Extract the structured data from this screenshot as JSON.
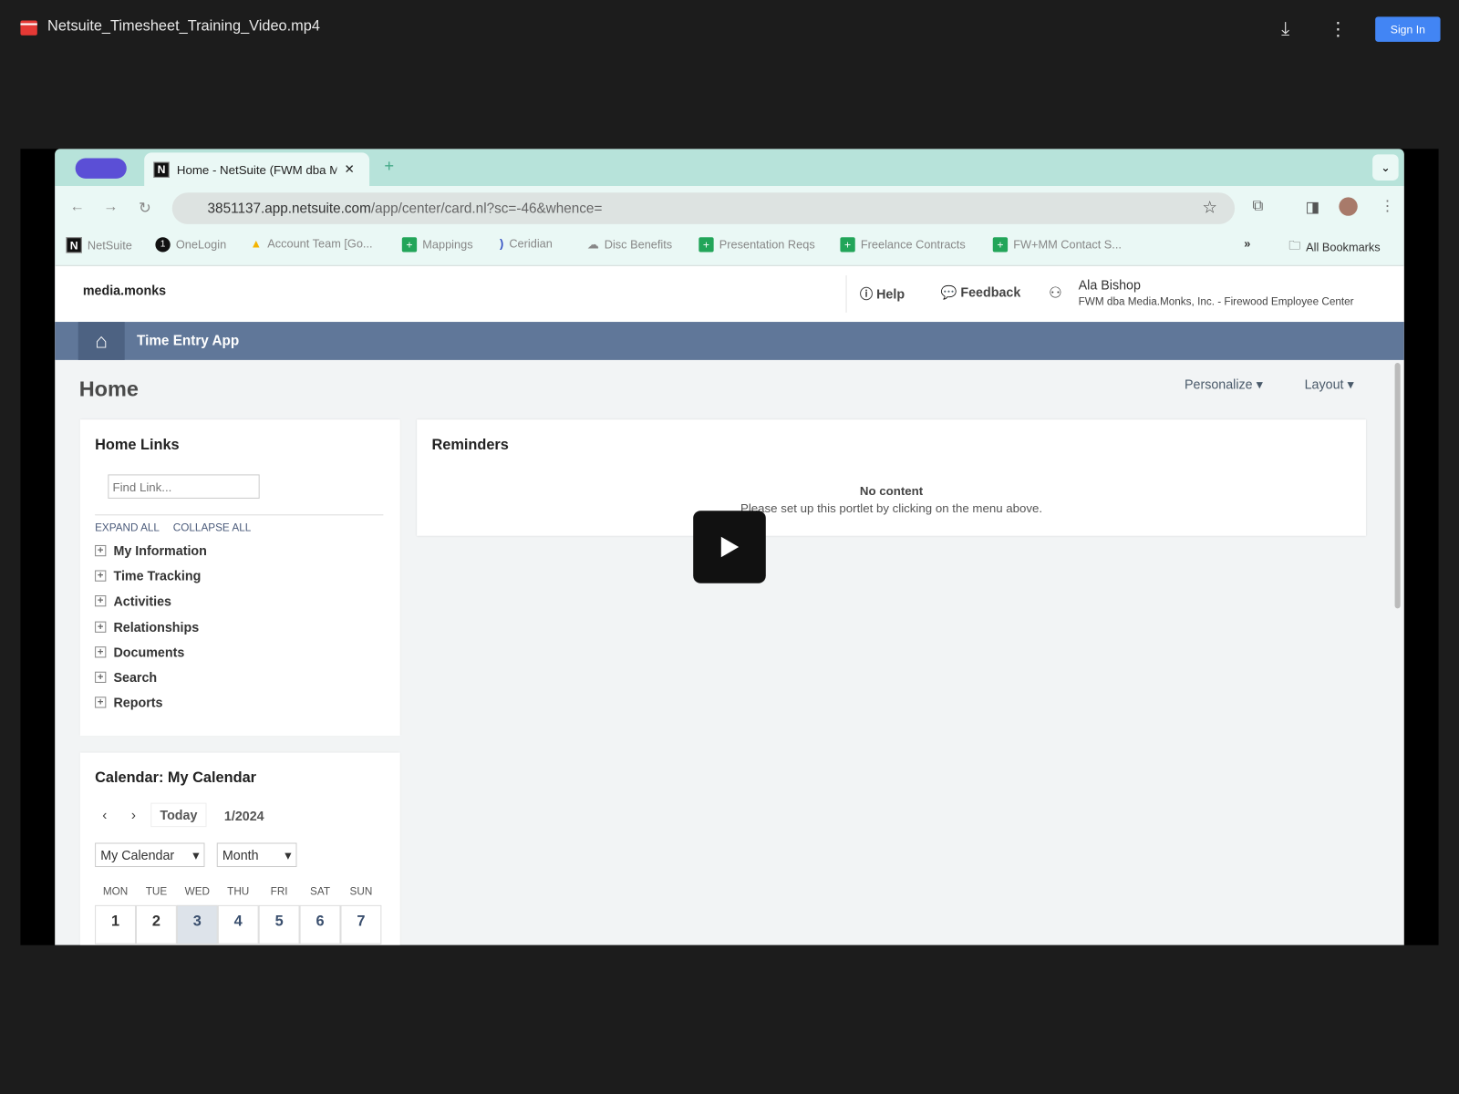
{
  "viewer": {
    "file_name": "Netsuite_Timesheet_Training_Video.mp4",
    "sign_in": "Sign In"
  },
  "browser": {
    "tab_title": "Home - NetSuite (FWM dba M",
    "url_host": "3851137.app.netsuite.com",
    "url_path": "/app/center/card.nl?sc=-46&whence=",
    "bookmarks": [
      "NetSuite",
      "OneLogin",
      "Account Team [Go...",
      "Mappings",
      "Ceridian",
      "Disc Benefits",
      "Presentation Reqs",
      "Freelance Contracts",
      "FW+MM Contact S..."
    ],
    "all_bookmarks": "All Bookmarks"
  },
  "netsuite": {
    "logo": "media.monks",
    "help": "Help",
    "feedback": "Feedback",
    "user_name": "Ala Bishop",
    "user_role": "FWM dba Media.Monks, Inc. - Firewood Employee Center",
    "app_title": "Time Entry App",
    "page_title": "Home",
    "personalize": "Personalize",
    "layout": "Layout",
    "home_links": {
      "title": "Home Links",
      "search_placeholder": "Find Link...",
      "expand_all": "EXPAND ALL",
      "collapse_all": "COLLAPSE ALL",
      "items": [
        "My Information",
        "Time Tracking",
        "Activities",
        "Relationships",
        "Documents",
        "Search",
        "Reports"
      ]
    },
    "reminders": {
      "title": "Reminders",
      "empty_title": "No content",
      "empty_text": "Please set up this portlet by clicking on the menu above."
    },
    "calendar": {
      "title": "Calendar: My Calendar",
      "today": "Today",
      "period": "1/2024",
      "calendar_select": "My Calendar",
      "view_select": "Month",
      "weekdays": [
        "MON",
        "TUE",
        "WED",
        "THU",
        "FRI",
        "SAT",
        "SUN"
      ],
      "days": [
        "1",
        "2",
        "3",
        "4",
        "5",
        "6",
        "7"
      ],
      "highlight_day": "3"
    }
  }
}
